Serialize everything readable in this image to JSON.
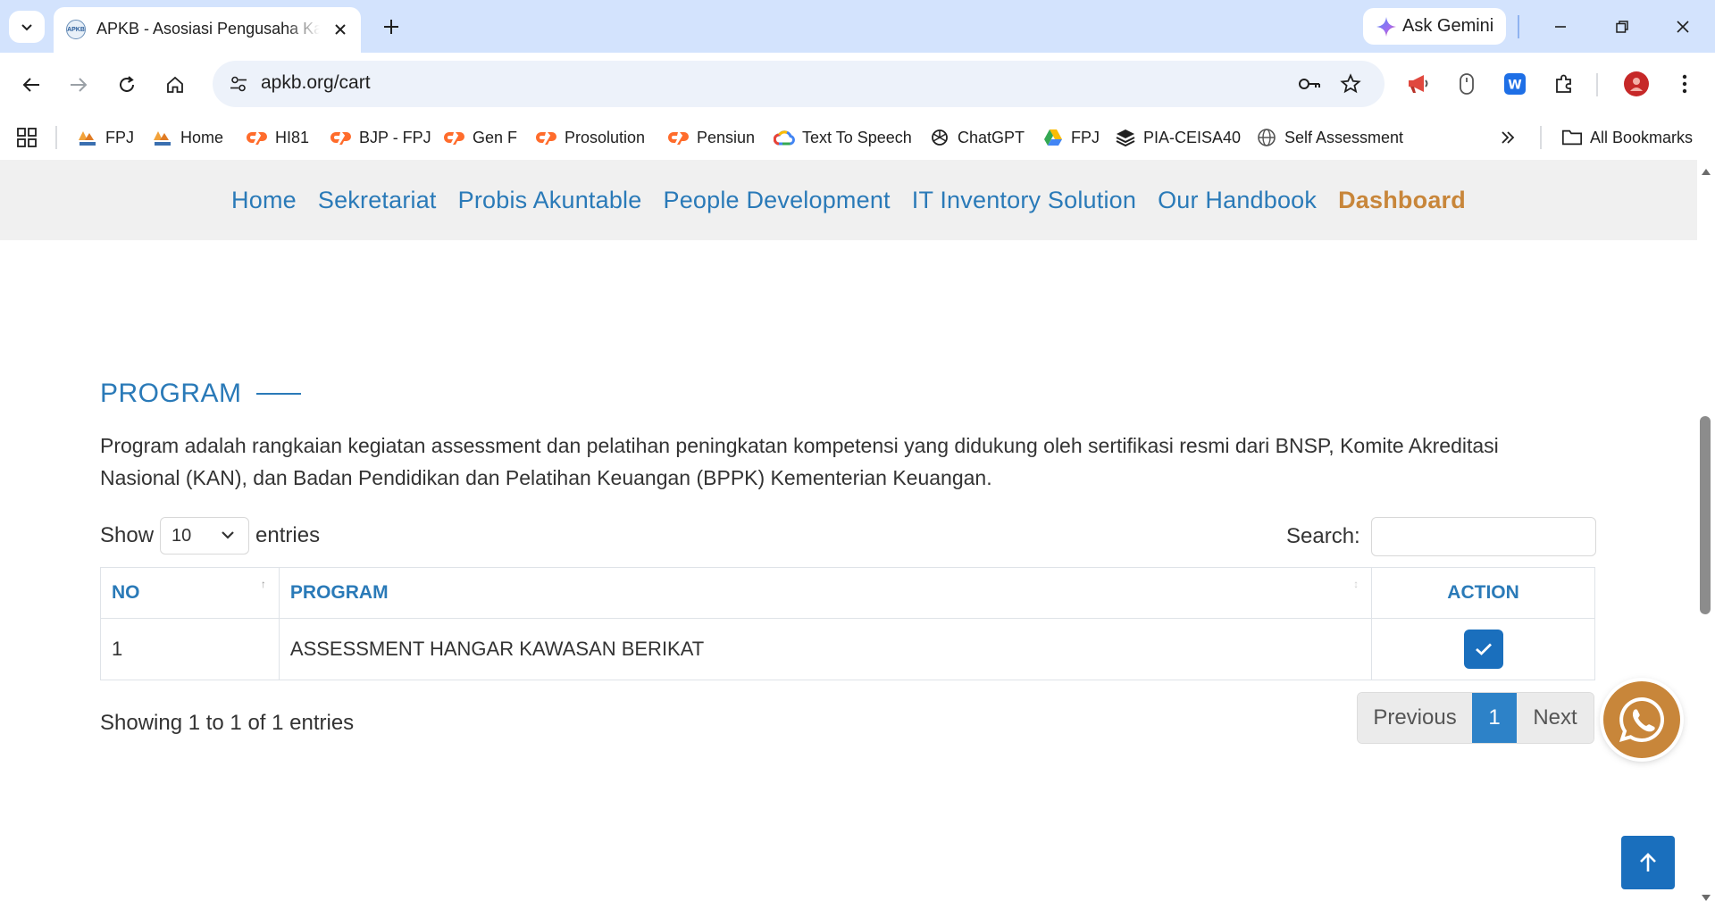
{
  "browser": {
    "tab_title": "APKB - Asosiasi Pengusaha Kawasan Berikat",
    "favicon_text": "APKB",
    "gemini_label": "Ask Gemini",
    "url": "apkb.org/cart",
    "bookmarks": [
      {
        "label": "FPJ",
        "icon": "pma-logo-icon"
      },
      {
        "label": "Home",
        "icon": "pma-logo-icon"
      },
      {
        "label": "HI81",
        "icon": "cpanel-icon"
      },
      {
        "label": "BJP - FPJ",
        "icon": "cpanel-icon"
      },
      {
        "label": "Gen F",
        "icon": "cpanel-icon"
      },
      {
        "label": "Prosolution",
        "icon": "cpanel-icon"
      },
      {
        "label": "Pensiun",
        "icon": "cpanel-icon"
      },
      {
        "label": "Text To Speech",
        "icon": "google-cloud-icon"
      },
      {
        "label": "ChatGPT",
        "icon": "openai-icon"
      },
      {
        "label": "FPJ",
        "icon": "google-drive-icon"
      },
      {
        "label": "PIA-CEISA40",
        "icon": "layers-icon"
      },
      {
        "label": "Self Assessment",
        "icon": "globe-icon"
      }
    ],
    "all_bookmarks_label": "All Bookmarks"
  },
  "site_nav": [
    {
      "label": "Home",
      "active": false
    },
    {
      "label": "Sekretariat",
      "active": false
    },
    {
      "label": "Probis Akuntable",
      "active": false
    },
    {
      "label": "People Development",
      "active": false
    },
    {
      "label": "IT Inventory Solution",
      "active": false
    },
    {
      "label": "Our Handbook",
      "active": false
    },
    {
      "label": "Dashboard",
      "active": true
    }
  ],
  "program": {
    "title": "PROGRAM",
    "description": "Program adalah rangkaian kegiatan assessment dan pelatihan peningkatan kompetensi yang didukung oleh sertifikasi resmi dari BNSP, Komite Akreditasi Nasional (KAN), dan Badan Pendidikan dan Pelatihan Keuangan (BPPK) Kementerian Keuangan.",
    "length_label_pre": "Show",
    "length_value": "10",
    "length_label_post": "entries",
    "search_label": "Search:",
    "columns": [
      "NO",
      "PROGRAM",
      "ACTION"
    ],
    "rows": [
      {
        "no": "1",
        "program": "ASSESSMENT HANGAR KAWASAN BERIKAT"
      }
    ],
    "info": "Showing 1 to 1 of 1 entries",
    "pagination": {
      "previous": "Previous",
      "current": "1",
      "next": "Next"
    }
  },
  "colors": {
    "nav_link": "#2a7ab8",
    "nav_active": "#c8863a",
    "primary_button": "#1a6fbd",
    "whatsapp_button": "#c8863a",
    "tabstrip_bg": "#d3e3fd"
  }
}
